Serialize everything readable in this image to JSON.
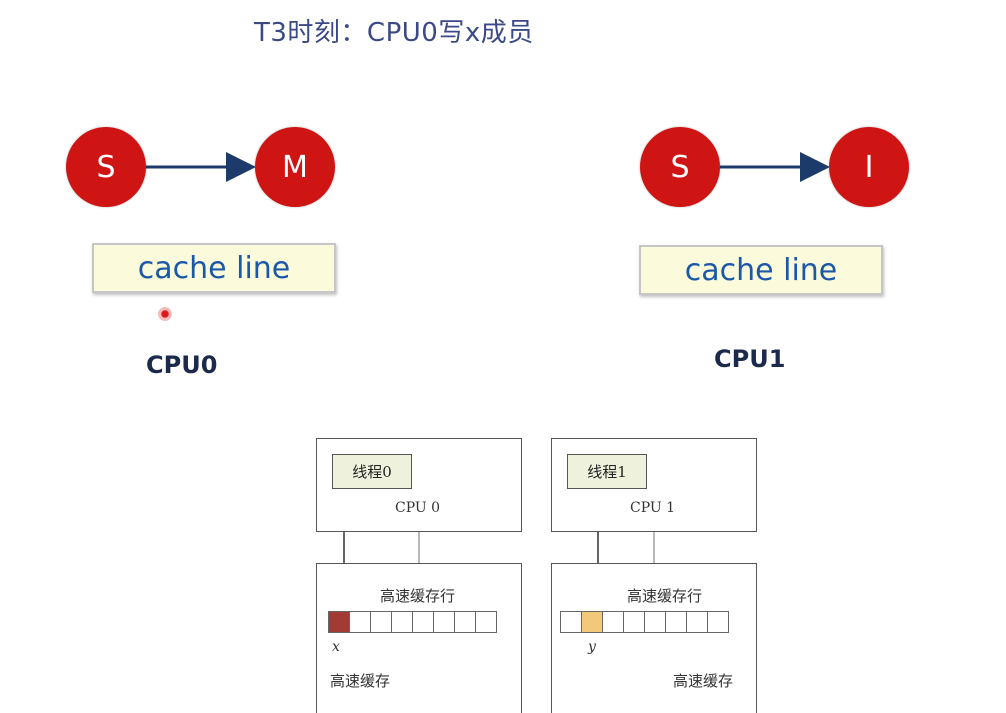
{
  "title": "T3时刻：CPU0写x成员",
  "cpu0": {
    "from_state": "S",
    "to_state": "M",
    "cache_line": "cache line",
    "label": "CPU0"
  },
  "cpu1": {
    "from_state": "S",
    "to_state": "I",
    "cache_line": "cache line",
    "label": "CPU1"
  },
  "colors": {
    "state": "#cf1414",
    "arrow": "#1c3a6a",
    "modified_cell": "#a33a33",
    "shared_cell": "#f2c879"
  },
  "schematic": {
    "left": {
      "thread": "线程0",
      "cpu": "CPU 0",
      "cache_line_label": "高速缓存行",
      "var": "x",
      "cache_label": "高速缓存"
    },
    "right": {
      "thread": "线程1",
      "cpu": "CPU 1",
      "cache_line_label": "高速缓存行",
      "var": "y",
      "cache_label": "高速缓存"
    }
  }
}
